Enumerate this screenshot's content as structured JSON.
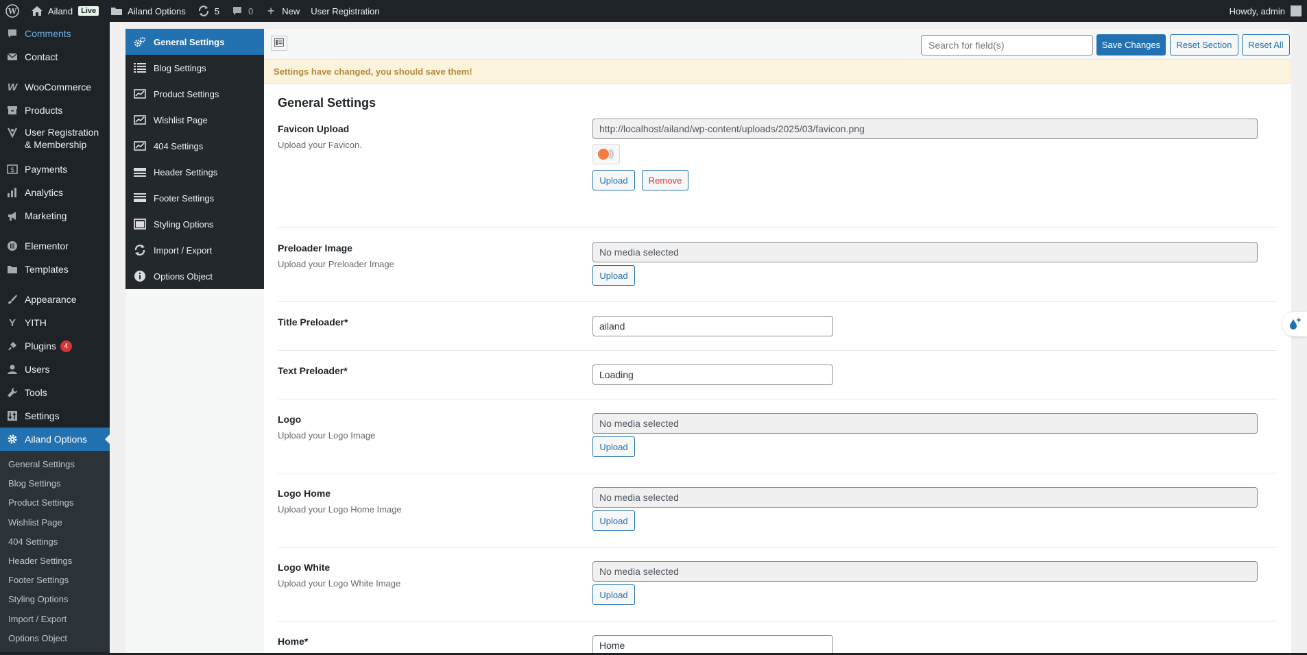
{
  "adminbar": {
    "site_name": "Ailand",
    "live_label": "Live",
    "options_label": "Ailand Options",
    "updates_count": "5",
    "comments_count": "0",
    "new_label": "New",
    "user_registration_label": "User Registration",
    "howdy_label": "Howdy, admin"
  },
  "admin_menu": {
    "comments": "Comments",
    "contact": "Contact",
    "woocommerce": "WooCommerce",
    "products": "Products",
    "user_registration": "User Registration & Membership",
    "payments": "Payments",
    "analytics": "Analytics",
    "marketing": "Marketing",
    "elementor": "Elementor",
    "templates": "Templates",
    "appearance": "Appearance",
    "yith": "YITH",
    "plugins": "Plugins",
    "plugins_badge": "4",
    "users": "Users",
    "tools": "Tools",
    "settings": "Settings",
    "ailand_options": "Ailand Options",
    "submenu": [
      "General Settings",
      "Blog Settings",
      "Product Settings",
      "Wishlist Page",
      "404 Settings",
      "Header Settings",
      "Footer Settings",
      "Styling Options",
      "Import / Export",
      "Options Object"
    ]
  },
  "options_nav": [
    {
      "label": "General Settings",
      "icon": "cogs-icon"
    },
    {
      "label": "Blog Settings",
      "icon": "list-icon"
    },
    {
      "label": "Product Settings",
      "icon": "chart-icon"
    },
    {
      "label": "Wishlist Page",
      "icon": "chart-icon"
    },
    {
      "label": "404 Settings",
      "icon": "chart-icon"
    },
    {
      "label": "Header Settings",
      "icon": "header-icon"
    },
    {
      "label": "Footer Settings",
      "icon": "footer-icon"
    },
    {
      "label": "Styling Options",
      "icon": "window-icon"
    },
    {
      "label": "Import / Export",
      "icon": "refresh-icon"
    },
    {
      "label": "Options Object",
      "icon": "info-icon"
    }
  ],
  "toolbar": {
    "search_placeholder": "Search for field(s)",
    "save_label": "Save Changes",
    "reset_section_label": "Reset Section",
    "reset_all_label": "Reset All"
  },
  "notice": "Settings have changed, you should save them!",
  "section_title": "General Settings",
  "fields": {
    "favicon": {
      "label": "Favicon Upload",
      "desc": "Upload your Favicon.",
      "value": "http://localhost/ailand/wp-content/uploads/2025/03/favicon.png",
      "upload_label": "Upload",
      "remove_label": "Remove"
    },
    "preloader_image": {
      "label": "Preloader Image",
      "desc": "Upload your Preloader Image",
      "value": "No media selected",
      "upload_label": "Upload"
    },
    "title_preloader": {
      "label": "Title Preloader*",
      "value": "ailand"
    },
    "text_preloader": {
      "label": "Text Preloader*",
      "value": "Loading"
    },
    "logo": {
      "label": "Logo",
      "desc": "Upload your Logo Image",
      "value": "No media selected",
      "upload_label": "Upload"
    },
    "logo_home": {
      "label": "Logo Home",
      "desc": "Upload your Logo Home Image",
      "value": "No media selected",
      "upload_label": "Upload"
    },
    "logo_white": {
      "label": "Logo White",
      "desc": "Upload your Logo White Image",
      "value": "No media selected",
      "upload_label": "Upload"
    },
    "home": {
      "label": "Home*",
      "value": "Home"
    }
  },
  "colors": {
    "accent": "#2271b1",
    "admin_dark": "#1d2327",
    "notice_bg": "#fcf3dc",
    "remove": "#d63638"
  }
}
